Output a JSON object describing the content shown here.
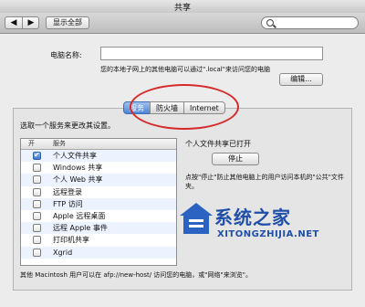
{
  "window": {
    "title": "共享"
  },
  "toolbar": {
    "back": "◀",
    "forward": "▶",
    "show_all": "显示全部",
    "search_placeholder": ""
  },
  "computer": {
    "name_label": "电脑名称:",
    "name_value": "",
    "hint": "您的本地子网上的其他电脑可以通过\".local\"来访问您的电脑",
    "edit_button": "编辑..."
  },
  "tabs": [
    {
      "label": "服务",
      "active": true
    },
    {
      "label": "防火墙",
      "active": false
    },
    {
      "label": "Internet",
      "active": false
    }
  ],
  "services": {
    "instruction": "选取一个服务来更改其设置。",
    "col_on": "开",
    "col_service": "服务",
    "items": [
      {
        "label": "个人文件共享",
        "on": true
      },
      {
        "label": "Windows 共享",
        "on": false
      },
      {
        "label": "个人 Web 共享",
        "on": false
      },
      {
        "label": "远程登录",
        "on": false
      },
      {
        "label": "FTP 访问",
        "on": false
      },
      {
        "label": "Apple 远程桌面",
        "on": false
      },
      {
        "label": "远程 Apple 事件",
        "on": false
      },
      {
        "label": "打印机共享",
        "on": false
      },
      {
        "label": "Xgrid",
        "on": false
      }
    ],
    "status": "个人文件共享已打开",
    "stop_button": "停止",
    "stop_note": "点按\"停止\"防止其他电脑上的用户访问本机的\"公共\"文件夹。",
    "footer": "其他 Macintosh 用户可以在 afp://new-host/ 访问您的电脑，或\"网络\"来浏览\"。"
  },
  "watermark": {
    "cn": "系统之家",
    "en": "XITONGZHIJIA.NET"
  },
  "colors": {
    "accent": "#3f78cf",
    "annotation": "#d62a2a"
  }
}
